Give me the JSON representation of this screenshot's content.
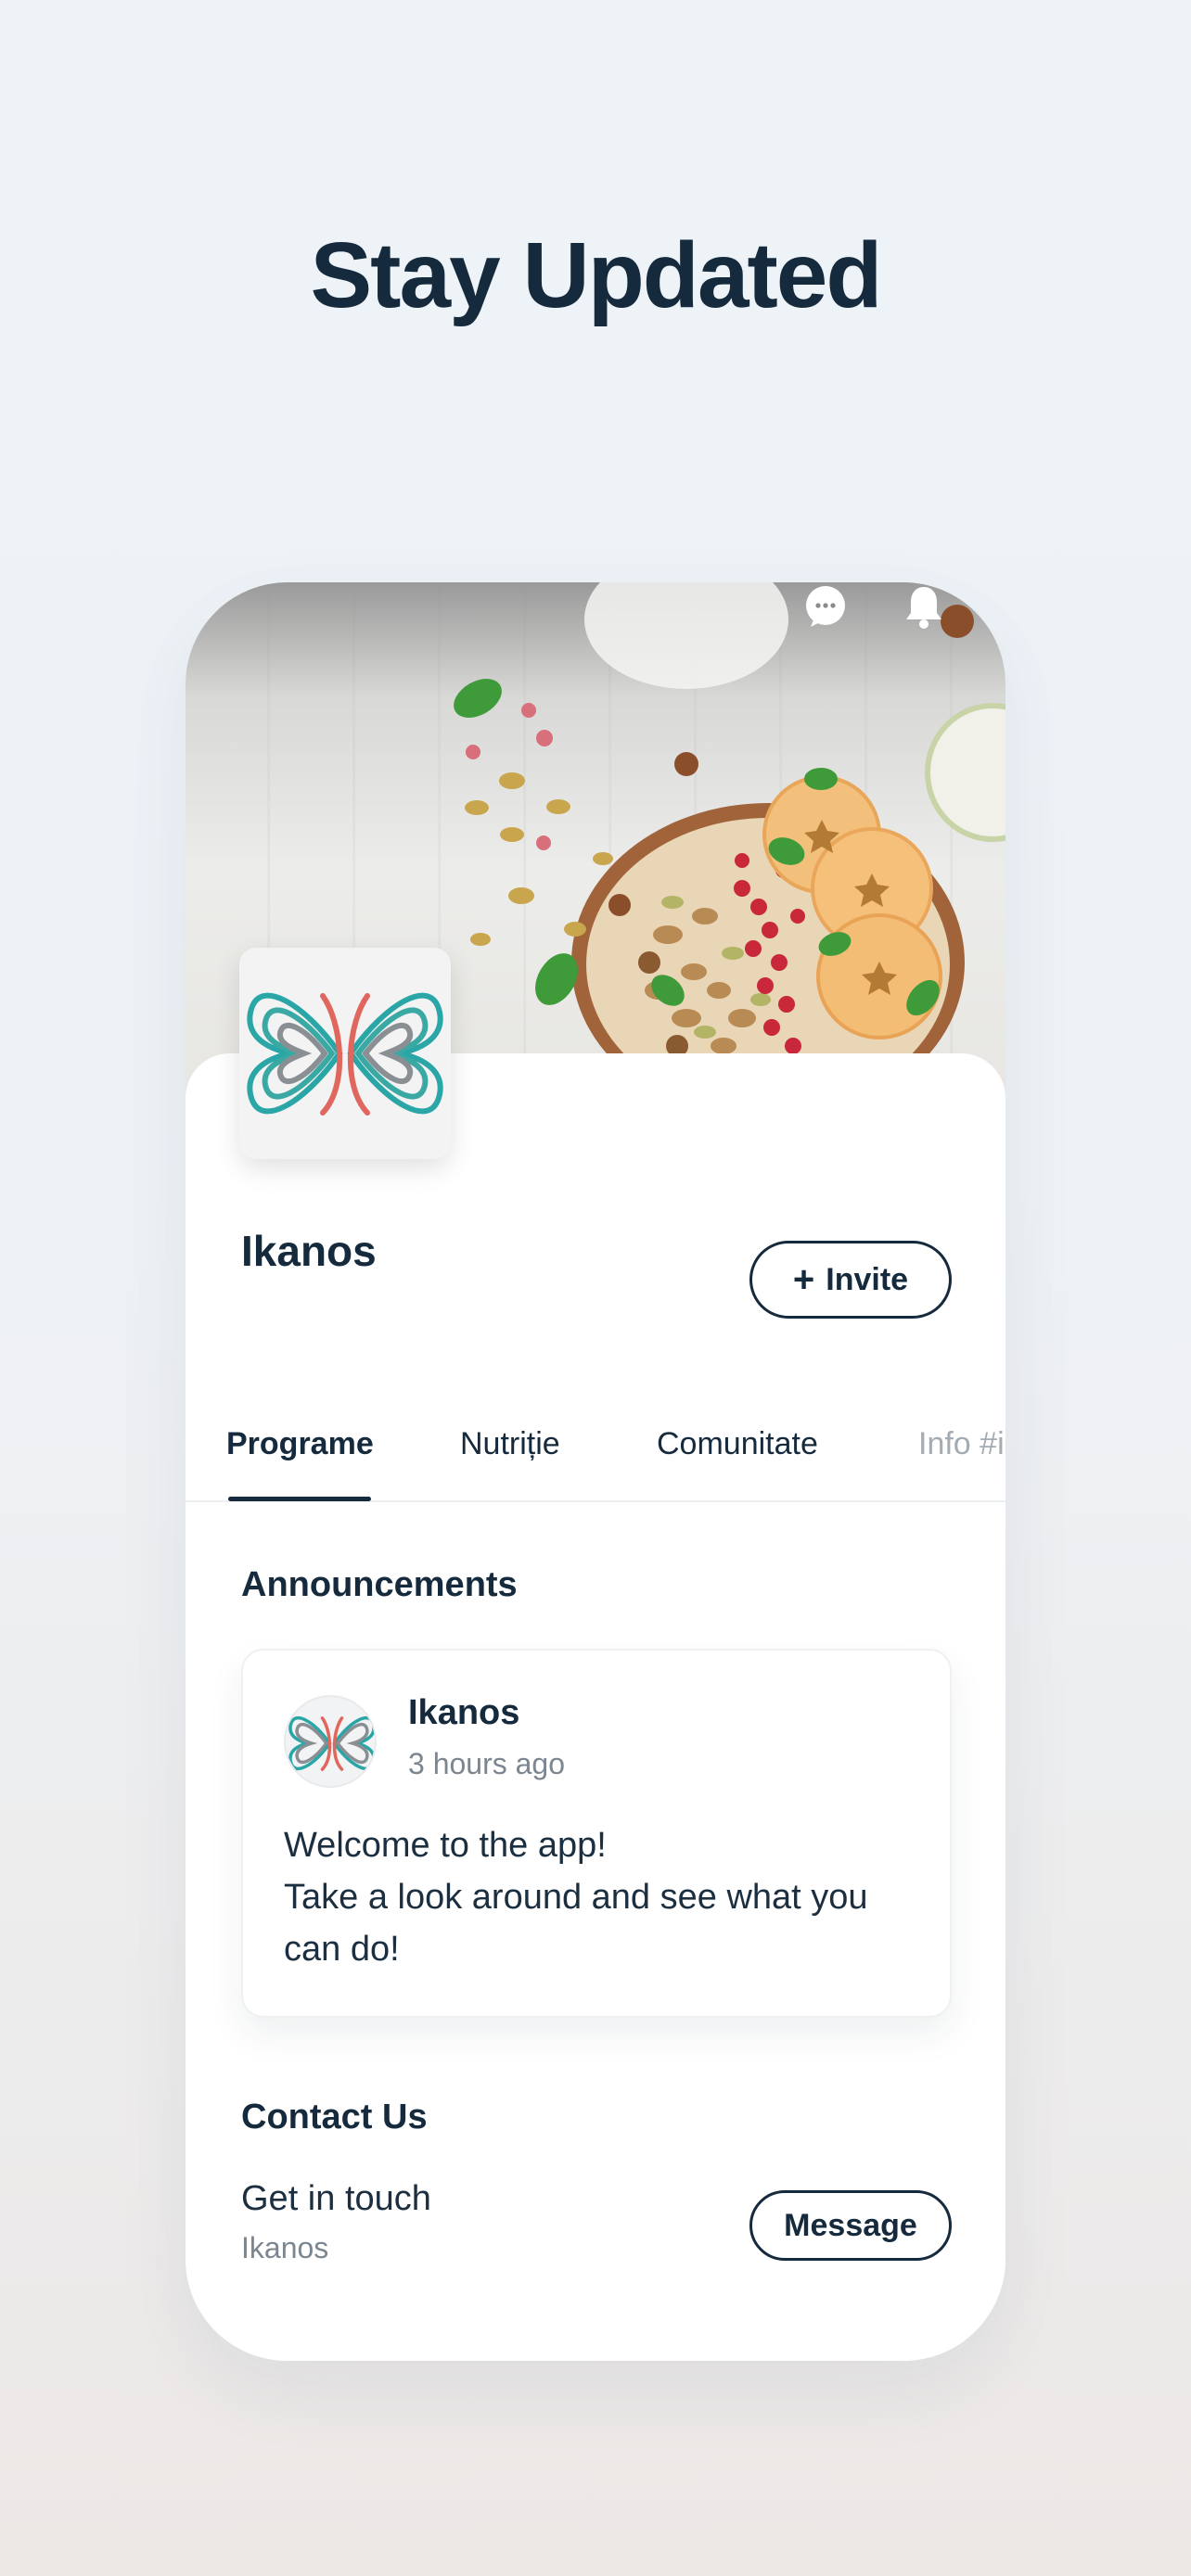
{
  "headline": "Stay Updated",
  "header": {
    "icons": [
      "chat-icon",
      "bell-icon"
    ]
  },
  "profile": {
    "name": "Ikanos",
    "invite_label": "Invite"
  },
  "tabs": [
    {
      "label": "Programe",
      "active": true
    },
    {
      "label": "Nutriție",
      "active": false
    },
    {
      "label": "Comunitate",
      "active": false
    },
    {
      "label": "Info #i",
      "active": false
    }
  ],
  "announcements": {
    "title": "Announcements",
    "post": {
      "author": "Ikanos",
      "time": "3 hours ago",
      "lines": [
        "Welcome to the app!",
        "Take a look around and see what you",
        "can do!"
      ]
    }
  },
  "contact": {
    "title": "Contact Us",
    "line1": "Get in touch",
    "line2": "Ikanos",
    "message_label": "Message"
  },
  "colors": {
    "ink": "#152a3d",
    "muted": "#7c8690",
    "logo_teal": "#2aa6a6",
    "logo_coral": "#e0675e"
  }
}
